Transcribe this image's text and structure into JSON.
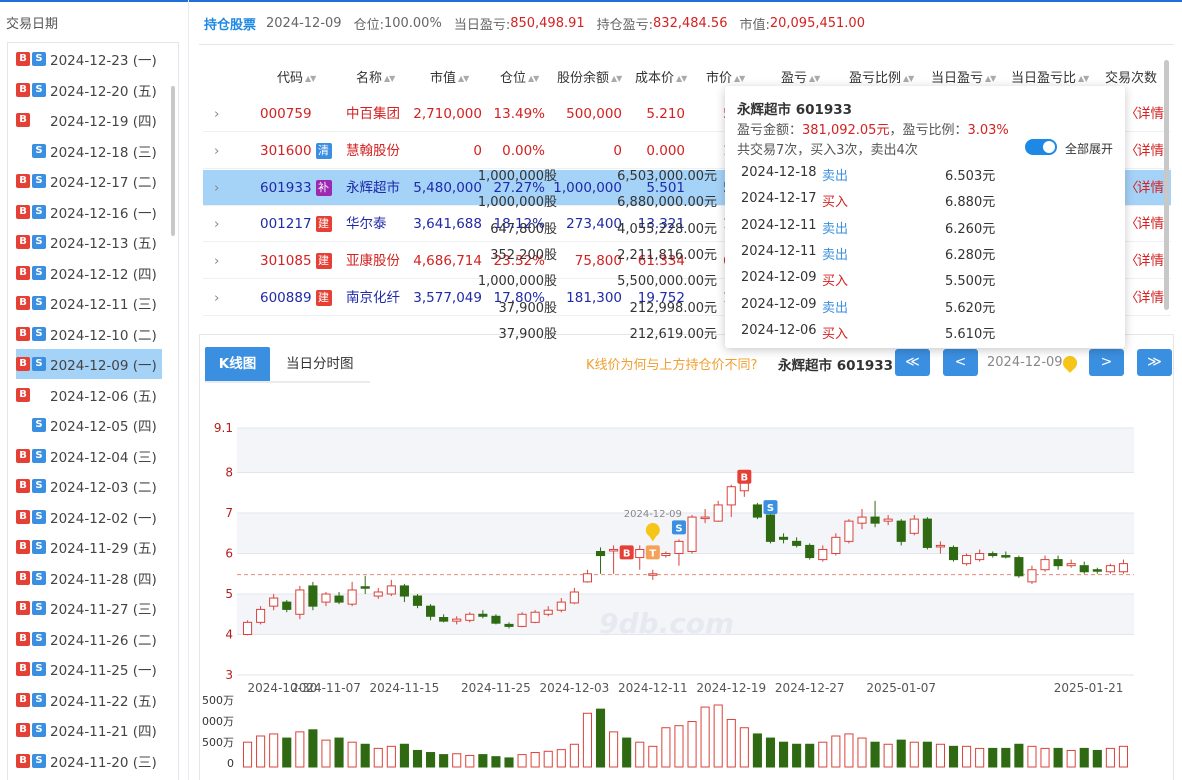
{
  "sidebar": {
    "title": "交易日期",
    "items": [
      {
        "b": true,
        "s": true,
        "date": "2024-12-23 (一)"
      },
      {
        "b": true,
        "s": true,
        "date": "2024-12-20 (五)"
      },
      {
        "b": true,
        "s": false,
        "date": "2024-12-19 (四)"
      },
      {
        "b": false,
        "s": true,
        "date": "2024-12-18 (三)"
      },
      {
        "b": true,
        "s": true,
        "date": "2024-12-17 (二)"
      },
      {
        "b": true,
        "s": true,
        "date": "2024-12-16 (一)"
      },
      {
        "b": true,
        "s": true,
        "date": "2024-12-13 (五)"
      },
      {
        "b": true,
        "s": true,
        "date": "2024-12-12 (四)"
      },
      {
        "b": true,
        "s": true,
        "date": "2024-12-11 (三)"
      },
      {
        "b": true,
        "s": true,
        "date": "2024-12-10 (二)"
      },
      {
        "b": true,
        "s": true,
        "date": "2024-12-09 (一)",
        "selected": true
      },
      {
        "b": true,
        "s": false,
        "date": "2024-12-06 (五)"
      },
      {
        "b": false,
        "s": true,
        "date": "2024-12-05 (四)"
      },
      {
        "b": true,
        "s": true,
        "date": "2024-12-04 (三)"
      },
      {
        "b": true,
        "s": true,
        "date": "2024-12-03 (二)"
      },
      {
        "b": true,
        "s": true,
        "date": "2024-12-02 (一)"
      },
      {
        "b": true,
        "s": true,
        "date": "2024-11-29 (五)"
      },
      {
        "b": true,
        "s": true,
        "date": "2024-11-28 (四)"
      },
      {
        "b": true,
        "s": true,
        "date": "2024-11-27 (三)"
      },
      {
        "b": true,
        "s": true,
        "date": "2024-11-26 (二)"
      },
      {
        "b": true,
        "s": true,
        "date": "2024-11-25 (一)"
      },
      {
        "b": true,
        "s": true,
        "date": "2024-11-22 (五)"
      },
      {
        "b": true,
        "s": true,
        "date": "2024-11-21 (四)"
      },
      {
        "b": true,
        "s": true,
        "date": "2024-11-20 (三)"
      }
    ]
  },
  "summary": {
    "link": "持仓股票",
    "date": "2024-12-09",
    "position_label": "仓位:",
    "position": "100.00%",
    "daily_pl_label": "当日盈亏:",
    "daily_pl": "850,498.91",
    "hold_pl_label": "持仓盈亏:",
    "hold_pl": "832,484.56",
    "mv_label": "市值:",
    "mv": "20,095,451.00"
  },
  "table": {
    "headers": [
      "代码",
      "名称",
      "市值",
      "仓位",
      "股份余额",
      "成本价",
      "市价",
      "盈亏",
      "盈亏比例",
      "当日盈亏",
      "当日盈亏比",
      "交易次数"
    ],
    "rows": [
      {
        "code": "000759",
        "tag": "",
        "tag_color": "",
        "name": "中百集团",
        "mv": "2,710,000",
        "pos": "13.49%",
        "qty": "500,000",
        "cost": "5.210",
        "price": "5.",
        "detail": "详情",
        "color": "red"
      },
      {
        "code": "301600",
        "tag": "清",
        "tag_color": "#3b8fe0",
        "name": "慧翰股份",
        "mv": "0",
        "pos": "0.00%",
        "qty": "0",
        "cost": "0.000",
        "price": "135.",
        "detail": "详情",
        "color": "red"
      },
      {
        "code": "601933",
        "tag": "补",
        "tag_color": "#9c27b0",
        "name": "永辉超市",
        "mv": "5,480,000",
        "pos": "27.27%",
        "qty": "1,000,000",
        "cost": "5.501",
        "price": "5.",
        "detail": "详情",
        "color": "blu",
        "selected": true
      },
      {
        "code": "001217",
        "tag": "建",
        "tag_color": "#e54036",
        "name": "华尔泰",
        "mv": "3,641,688",
        "pos": "18.12%",
        "qty": "273,400",
        "cost": "13.321",
        "price": "13.",
        "detail": "详情",
        "color": "blu"
      },
      {
        "code": "301085",
        "tag": "建",
        "tag_color": "#e54036",
        "name": "亚康股份",
        "mv": "4,686,714",
        "pos": "23.32%",
        "qty": "75,800",
        "cost": "61.334",
        "price": "61.",
        "detail": "详情",
        "color": "red"
      },
      {
        "code": "600889",
        "tag": "建",
        "tag_color": "#e54036",
        "name": "南京化纤",
        "mv": "3,577,049",
        "pos": "17.80%",
        "qty": "181,300",
        "cost": "19.752",
        "price": "19.",
        "detail": "详情",
        "color": "blu"
      }
    ]
  },
  "popup": {
    "title": "永辉超市 601933",
    "pl_label": "盈亏金额：",
    "pl_value": "381,092.05元",
    "ratio_label": "，盈亏比例：",
    "ratio_value": "3.03%",
    "summary": "共交易7次，买入3次，卖出4次",
    "toggle_label": "全部展开",
    "trades": [
      {
        "date": "2024-12-18",
        "side": "卖出",
        "qty": "1,000,000股",
        "price": "6.503元",
        "amount": "6,503,000.00元"
      },
      {
        "date": "2024-12-17",
        "side": "买入",
        "qty": "1,000,000股",
        "price": "6.880元",
        "amount": "6,880,000.00元"
      },
      {
        "date": "2024-12-11",
        "side": "卖出",
        "qty": "647,800股",
        "price": "6.260元",
        "amount": "4,055,228.00元"
      },
      {
        "date": "2024-12-11",
        "side": "卖出",
        "qty": "352,200股",
        "price": "6.280元",
        "amount": "2,211,816.00元"
      },
      {
        "date": "2024-12-09",
        "side": "买入",
        "qty": "1,000,000股",
        "price": "5.500元",
        "amount": "5,500,000.00元"
      },
      {
        "date": "2024-12-09",
        "side": "卖出",
        "qty": "37,900股",
        "price": "5.620元",
        "amount": "212,998.00元"
      },
      {
        "date": "2024-12-06",
        "side": "买入",
        "qty": "37,900股",
        "price": "5.610元",
        "amount": "212,619.00元"
      }
    ]
  },
  "chart_tabs": {
    "k": "K线图",
    "t": "当日分时图"
  },
  "nav": {
    "question": "K线价为何与上方持仓价不同?",
    "name": "永辉超市 601933",
    "first": "≪",
    "prev": "<",
    "next": ">",
    "last": "≫",
    "date": "2024-12-09"
  },
  "colors": {
    "up": "#d9433b",
    "down": "#2f6a13",
    "accent": "#3b8fe0",
    "cost_line": "#e88a7a"
  },
  "chart_data": {
    "type": "candlestick",
    "ylim": [
      3,
      9.1
    ],
    "y_ticks": [
      "9.1",
      "8",
      "7",
      "6",
      "5",
      "4",
      "3"
    ],
    "x_tick_labels": [
      "2024-10-30",
      "2024-11-07",
      "2024-11-15",
      "2024-11-25",
      "2024-12-03",
      "2024-12-11",
      "2024-12-19",
      "2024-12-27",
      "2025-01-07",
      "2025-01-21"
    ],
    "cost_line": 5.48,
    "marker_date": "2024-12-09",
    "volume_ticks": [
      "500万",
      "000万",
      "500万",
      "0"
    ],
    "watermark": "9db.com",
    "candles": [
      [
        4.0,
        4.3,
        3.98,
        4.35
      ],
      [
        4.3,
        4.62,
        4.25,
        4.7
      ],
      [
        4.7,
        4.9,
        4.6,
        5.0
      ],
      [
        4.8,
        4.62,
        4.55,
        4.85
      ],
      [
        4.5,
        5.1,
        4.38,
        5.2
      ],
      [
        5.2,
        4.7,
        4.6,
        5.3
      ],
      [
        4.8,
        5.0,
        4.7,
        5.05
      ],
      [
        4.95,
        4.8,
        4.75,
        5.05
      ],
      [
        4.75,
        5.1,
        4.7,
        5.3
      ],
      [
        5.18,
        5.15,
        5.0,
        5.45
      ],
      [
        4.95,
        5.05,
        4.88,
        5.15
      ],
      [
        5.0,
        5.2,
        4.95,
        5.35
      ],
      [
        5.2,
        4.95,
        4.8,
        5.25
      ],
      [
        4.95,
        4.72,
        4.65,
        5.0
      ],
      [
        4.7,
        4.45,
        4.35,
        4.75
      ],
      [
        4.42,
        4.33,
        4.3,
        4.5
      ],
      [
        4.33,
        4.38,
        4.25,
        4.45
      ],
      [
        4.35,
        4.5,
        4.3,
        4.55
      ],
      [
        4.5,
        4.45,
        4.4,
        4.6
      ],
      [
        4.45,
        4.28,
        4.25,
        4.5
      ],
      [
        4.25,
        4.2,
        4.15,
        4.3
      ],
      [
        4.2,
        4.5,
        4.18,
        4.55
      ],
      [
        4.3,
        4.55,
        4.28,
        4.6
      ],
      [
        4.5,
        4.6,
        4.45,
        4.7
      ],
      [
        4.6,
        4.8,
        4.55,
        4.9
      ],
      [
        4.78,
        5.05,
        4.75,
        5.15
      ],
      [
        5.3,
        5.5,
        5.28,
        5.6
      ],
      [
        6.05,
        5.95,
        5.5,
        6.15
      ],
      [
        6.1,
        6.1,
        5.5,
        6.2
      ],
      [
        6.05,
        5.95,
        5.9,
        6.1
      ],
      [
        5.9,
        6.1,
        5.6,
        6.2
      ],
      [
        5.5,
        5.5,
        5.35,
        5.6
      ],
      [
        5.95,
        6.0,
        5.9,
        6.05
      ],
      [
        6.0,
        6.3,
        5.7,
        6.35
      ],
      [
        6.05,
        6.9,
        6.0,
        6.95
      ],
      [
        6.9,
        6.9,
        6.75,
        7.1
      ],
      [
        6.8,
        7.2,
        6.78,
        7.3
      ],
      [
        7.2,
        7.65,
        6.9,
        7.7
      ],
      [
        7.55,
        7.75,
        7.4,
        7.85
      ],
      [
        7.2,
        6.9,
        6.85,
        7.25
      ],
      [
        6.95,
        6.3,
        6.25,
        7.0
      ],
      [
        6.4,
        6.35,
        6.25,
        6.5
      ],
      [
        6.3,
        6.2,
        6.15,
        6.4
      ],
      [
        6.2,
        5.9,
        5.85,
        6.25
      ],
      [
        5.85,
        6.1,
        5.8,
        6.2
      ],
      [
        6.0,
        6.4,
        5.95,
        6.5
      ],
      [
        6.3,
        6.8,
        6.25,
        6.85
      ],
      [
        6.75,
        6.9,
        6.6,
        7.1
      ],
      [
        6.9,
        6.75,
        6.65,
        7.3
      ],
      [
        6.8,
        6.85,
        6.7,
        6.95
      ],
      [
        6.8,
        6.3,
        6.2,
        6.85
      ],
      [
        6.5,
        6.85,
        6.45,
        6.95
      ],
      [
        6.85,
        6.15,
        6.1,
        6.9
      ],
      [
        6.2,
        6.2,
        6.0,
        6.3
      ],
      [
        6.15,
        5.85,
        5.8,
        6.2
      ],
      [
        5.75,
        5.95,
        5.7,
        6.0
      ],
      [
        5.85,
        6.0,
        5.8,
        6.1
      ],
      [
        6.0,
        5.95,
        5.9,
        6.05
      ],
      [
        5.95,
        5.92,
        5.88,
        6.05
      ],
      [
        5.9,
        5.45,
        5.4,
        5.95
      ],
      [
        5.3,
        5.6,
        5.25,
        5.7
      ],
      [
        5.6,
        5.85,
        5.55,
        5.95
      ],
      [
        5.85,
        5.7,
        5.6,
        5.95
      ],
      [
        5.7,
        5.75,
        5.65,
        5.85
      ],
      [
        5.7,
        5.55,
        5.5,
        5.8
      ],
      [
        5.6,
        5.58,
        5.5,
        5.65
      ],
      [
        5.55,
        5.7,
        5.5,
        5.75
      ],
      [
        5.55,
        5.75,
        5.5,
        5.85
      ]
    ],
    "volumes": [
      60,
      75,
      80,
      70,
      85,
      90,
      65,
      70,
      60,
      55,
      45,
      50,
      55,
      40,
      35,
      30,
      32,
      28,
      30,
      25,
      22,
      30,
      35,
      38,
      42,
      55,
      130,
      140,
      85,
      70,
      60,
      50,
      95,
      100,
      110,
      145,
      150,
      115,
      95,
      80,
      70,
      60,
      55,
      55,
      60,
      75,
      80,
      70,
      60,
      55,
      65,
      60,
      60,
      55,
      50,
      50,
      45,
      45,
      45,
      55,
      50,
      45,
      45,
      40,
      45,
      40,
      45,
      50
    ]
  }
}
